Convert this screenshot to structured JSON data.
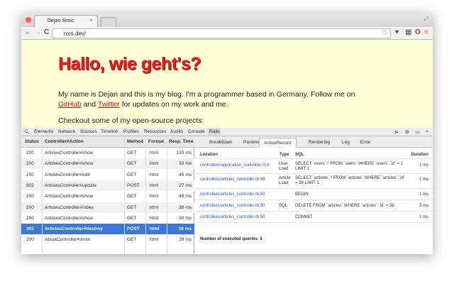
{
  "browser": {
    "tab_title": "Dejan Simic",
    "url": "rors.dev/"
  },
  "page": {
    "heading": "Hallo, wie geht's?",
    "intro_1": "My name is Dejan and this is my blog. I'm a programmer based in Germany. Follow me on ",
    "github": "GitHub",
    "and": " and ",
    "twitter": "Twitter",
    "intro_2": " for updates on my work and me.",
    "projects": "Checkout some of my open-source projects:"
  },
  "devtools": {
    "tabs": [
      "Elements",
      "Network",
      "Sources",
      "Timeline",
      "Profiles",
      "Resources",
      "Audits",
      "Console",
      "Rails"
    ],
    "active_tab": "Rails"
  },
  "requests": {
    "headers": [
      "Status",
      "Controller#Action",
      "Method",
      "Format",
      "Resp. Time"
    ],
    "rows": [
      [
        "200",
        "ArticlesController#show",
        "GET",
        "html",
        "133 ms"
      ],
      [
        "200",
        "ArticlesController#show",
        "GET",
        "html",
        "32 ms"
      ],
      [
        "200",
        "ArticlesController#edit",
        "GET",
        "html",
        "45 ms"
      ],
      [
        "302",
        "ArticlesController#update",
        "POST",
        "html",
        "27 ms"
      ],
      [
        "200",
        "ArticlesController#show",
        "GET",
        "html",
        "49 ms"
      ],
      [
        "200",
        "ArticlesController#index",
        "GET",
        "html",
        "38 ms"
      ],
      [
        "200",
        "ArticlesController#show",
        "GET",
        "html",
        "50 ms"
      ],
      [
        "302",
        "ArticlesController#destroy",
        "POST",
        "html",
        "19 ms"
      ],
      [
        "200",
        "AboutController#show",
        "GET",
        "html",
        "29 ms"
      ]
    ],
    "selected_index": 7
  },
  "detail": {
    "tabs": [
      "Breakdown",
      "Params",
      "ActiveRecord",
      "Rendering",
      "Log",
      "Error"
    ],
    "active_tab": "ActiveRecord",
    "headers": [
      "Location",
      "Type",
      "SQL",
      "Duration"
    ],
    "rows": [
      [
        "controllers/application_controller.rb:8",
        "User Load",
        "SELECT `users`.* FROM `users` WHERE `users`.`id` = 1 LIMIT 1",
        "1 ms"
      ],
      [
        "controllers/articles_controller.rb:49",
        "Article Load",
        "SELECT `articles`.* FROM `articles` WHERE `articles`.`id` = 38 LIMIT 1",
        "1 ms"
      ],
      [
        "controllers/articles_controller.rb:50",
        "",
        "BEGIN",
        "1 ms"
      ],
      [
        "controllers/articles_controller.rb:50",
        "SQL",
        "DELETE FROM `articles` WHERE `articles`.`id` = 38",
        "3 ms"
      ],
      [
        "controllers/articles_controller.rb:50",
        "",
        "COMMIT",
        "1 ms"
      ]
    ],
    "summary": "Number of executed queries: 5"
  }
}
